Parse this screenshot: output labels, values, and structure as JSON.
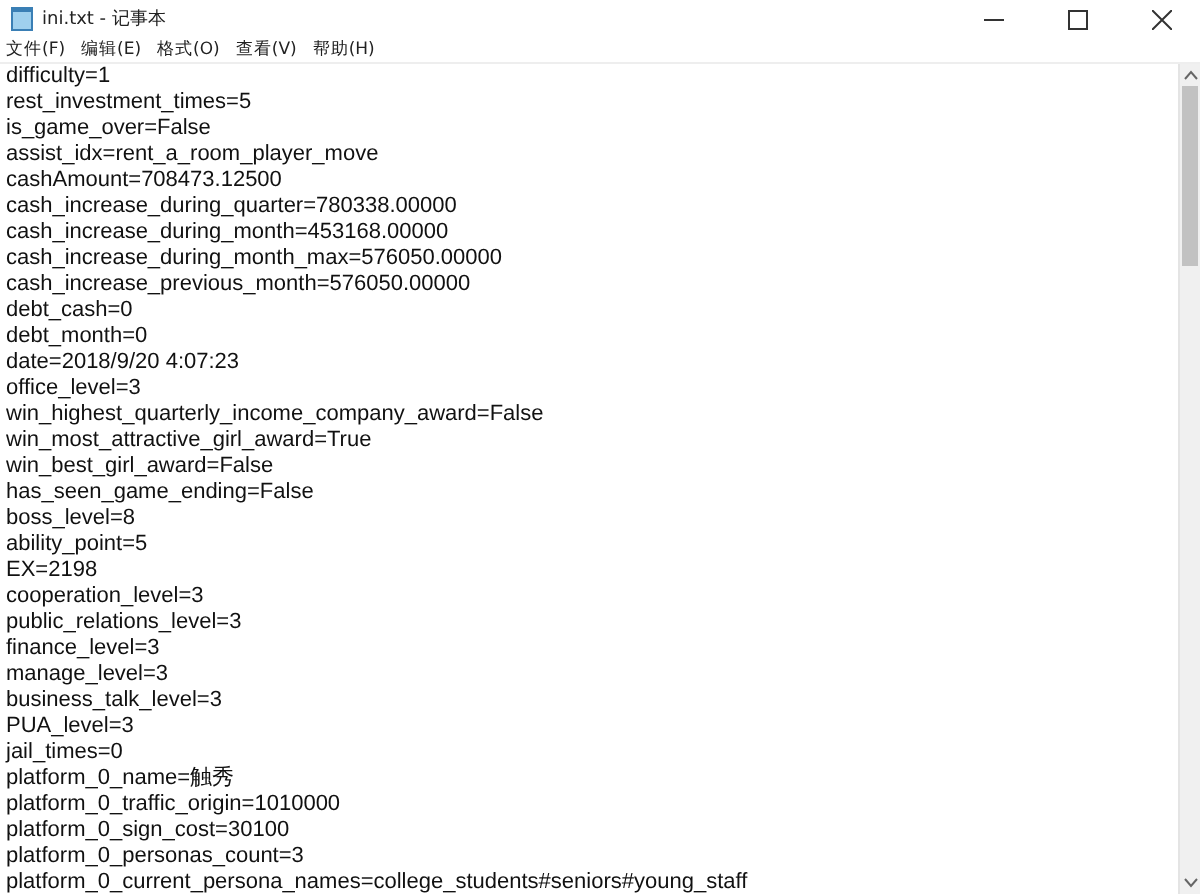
{
  "window": {
    "title": "ini.txt - 记事本"
  },
  "menu": [
    "文件(F)",
    "编辑(E)",
    "格式(O)",
    "查看(V)",
    "帮助(H)"
  ],
  "lines": [
    "difficulty=1",
    "rest_investment_times=5",
    "is_game_over=False",
    "assist_idx=rent_a_room_player_move",
    "cashAmount=708473.12500",
    "cash_increase_during_quarter=780338.00000",
    "cash_increase_during_month=453168.00000",
    "cash_increase_during_month_max=576050.00000",
    "cash_increase_previous_month=576050.00000",
    "debt_cash=0",
    "debt_month=0",
    "date=2018/9/20 4:07:23",
    "office_level=3",
    "win_highest_quarterly_income_company_award=False",
    "win_most_attractive_girl_award=True",
    "win_best_girl_award=False",
    "has_seen_game_ending=False",
    "boss_level=8",
    "ability_point=5",
    "EX=2198",
    "cooperation_level=3",
    "public_relations_level=3",
    "finance_level=3",
    "manage_level=3",
    "business_talk_level=3",
    "PUA_level=3",
    "jail_times=0",
    "platform_0_name=触秀",
    "platform_0_traffic_origin=1010000",
    "platform_0_sign_cost=30100",
    "platform_0_personas_count=3",
    "platform_0_current_persona_names=college_students#seniors#young_staff"
  ]
}
